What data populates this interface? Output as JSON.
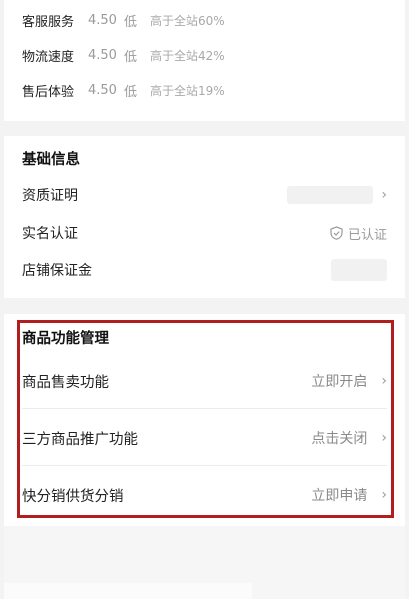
{
  "ratings": [
    {
      "label": "客服服务",
      "score": "4.50",
      "level": "低",
      "compare": "高于全站60%"
    },
    {
      "label": "物流速度",
      "score": "4.50",
      "level": "低",
      "compare": "高于全站42%"
    },
    {
      "label": "售后体验",
      "score": "4.50",
      "level": "低",
      "compare": "高于全站19%"
    }
  ],
  "basic": {
    "title": "基础信息",
    "qualification": "资质证明",
    "realname": "实名认证",
    "realname_status": "已认证",
    "deposit": "店铺保证金"
  },
  "functions": {
    "title": "商品功能管理",
    "items": [
      {
        "label": "商品售卖功能",
        "action": "立即开启"
      },
      {
        "label": "三方商品推广功能",
        "action": "点击关闭"
      },
      {
        "label": "快分销供货分销",
        "action": "立即申请"
      }
    ]
  },
  "icons": {
    "chevron": "chevron-right-icon",
    "verified": "shield-check-icon"
  },
  "colors": {
    "highlight": "#b01e1e",
    "muted": "#9a9a9a"
  }
}
